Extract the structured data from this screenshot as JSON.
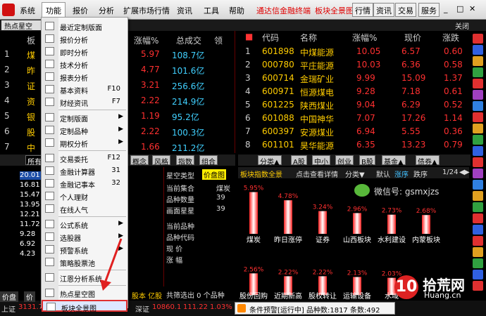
{
  "menubar": {
    "items": [
      "系统",
      "功能",
      "报价",
      "分析",
      "扩展市场行情",
      "资讯",
      "工具",
      "帮助"
    ],
    "promo1": "通达信金融终端",
    "promo2": "板块全景图",
    "right_buttons": [
      "行情",
      "资讯",
      "交易",
      "服务"
    ]
  },
  "toolbar": {
    "hot_tab": "热点星空",
    "close_label": "关闭"
  },
  "left_table": {
    "headers": [
      "板",
      "涨幅%",
      "总成交",
      "领"
    ],
    "rows": [
      {
        "name": "煤",
        "pct": "5.97",
        "vol": "108.7亿"
      },
      {
        "name": "昨",
        "pct": "4.77",
        "vol": "101.6亿"
      },
      {
        "name": "证",
        "pct": "3.21",
        "vol": "256.6亿"
      },
      {
        "name": "资",
        "pct": "2.22",
        "vol": "214.9亿"
      },
      {
        "name": "银",
        "pct": "1.19",
        "vol": "95.2亿"
      },
      {
        "name": "股",
        "pct": "2.22",
        "vol": "100.3亿"
      },
      {
        "name": "中",
        "pct": "1.66",
        "vol": "211.2亿"
      }
    ]
  },
  "right_table": {
    "headers": [
      "代码",
      "名称",
      "涨幅%",
      "现价",
      "涨跌"
    ],
    "rows": [
      {
        "n": "1",
        "code": "601898",
        "name": "中煤能源",
        "pct": "10.05",
        "price": "6.57",
        "chg": "0.60"
      },
      {
        "n": "2",
        "code": "000780",
        "name": "平庄能源",
        "pct": "10.03",
        "price": "6.36",
        "chg": "0.58"
      },
      {
        "n": "3",
        "code": "600714",
        "name": "金瑞矿业",
        "pct": "9.99",
        "price": "15.09",
        "chg": "1.37"
      },
      {
        "n": "4",
        "code": "600971",
        "name": "恒源煤电",
        "pct": "9.28",
        "price": "7.18",
        "chg": "0.61"
      },
      {
        "n": "5",
        "code": "601225",
        "name": "陕西煤业",
        "pct": "9.04",
        "price": "6.29",
        "chg": "0.52"
      },
      {
        "n": "6",
        "code": "601088",
        "name": "中国神华",
        "pct": "7.07",
        "price": "17.26",
        "chg": "1.14"
      },
      {
        "n": "7",
        "code": "600397",
        "name": "安源煤业",
        "pct": "6.94",
        "price": "5.55",
        "chg": "0.36"
      },
      {
        "n": "8",
        "code": "601101",
        "name": "昊华能源",
        "pct": "6.35",
        "price": "13.23",
        "chg": "0.79"
      }
    ]
  },
  "left_tabs": [
    "所有",
    "概念",
    "风格",
    "指数",
    "组合"
  ],
  "right_tabs": [
    "分类▲",
    "A股",
    "中小",
    "创业",
    "B股",
    "基金▲",
    "债券▲"
  ],
  "left_values": [
    "20.01",
    "16.81",
    "15.47",
    "13.95",
    "12.21",
    "11.72",
    "9.28",
    "6.92",
    "4.23"
  ],
  "mid_panel": {
    "title1": "星空类型",
    "title2": "价盘图",
    "rows": [
      {
        "k": "当前集合",
        "v": "煤炭"
      },
      {
        "k": "品种数量",
        "v": "39"
      },
      {
        "k": "画面星星",
        "v": "39"
      }
    ],
    "rows2": [
      "当前品种",
      "品种代码",
      "现 价",
      "涨 幅"
    ],
    "status": "共筛选出 0 个品种"
  },
  "chart_panel": {
    "title": "板块指数全景",
    "hint": "点击查看详情",
    "sort": "分类▼",
    "default": "默认",
    "rise": "涨序",
    "fall": "跌序",
    "page": "1/24",
    "wechat": "微信号: gsmxjzs"
  },
  "chart_data": [
    {
      "type": "bar",
      "categories": [
        "煤炭",
        "昨日涨停",
        "证券",
        "山西板块",
        "水利建设",
        "内蒙板块"
      ],
      "values": [
        5.95,
        4.78,
        3.24,
        2.96,
        2.73,
        2.68
      ],
      "ylim": [
        0,
        6
      ]
    },
    {
      "type": "bar",
      "categories": [
        "股份回购",
        "近期新高",
        "股权转让",
        "运输设备",
        "水域"
      ],
      "values": [
        2.56,
        2.22,
        2.22,
        2.13,
        2.03
      ],
      "ylim": [
        0,
        3
      ]
    }
  ],
  "menu": {
    "items": [
      {
        "label": "最近定制版面",
        "shortcut": "",
        "arrow": false
      },
      {
        "label": "报价分析",
        "shortcut": "",
        "arrow": false
      },
      {
        "label": "即时分析",
        "shortcut": "",
        "arrow": false
      },
      {
        "label": "技术分析",
        "shortcut": "",
        "arrow": false
      },
      {
        "label": "报表分析",
        "shortcut": "",
        "arrow": false
      },
      {
        "label": "基本资料",
        "shortcut": "F10",
        "arrow": false
      },
      {
        "label": "财经资讯",
        "shortcut": "F7",
        "arrow": false
      },
      {
        "label": "定制版面",
        "shortcut": "",
        "arrow": true
      },
      {
        "label": "定制品种",
        "shortcut": "",
        "arrow": true
      },
      {
        "label": "期权分析",
        "shortcut": "",
        "arrow": true
      },
      {
        "label": "交易委托",
        "shortcut": "F12",
        "arrow": false
      },
      {
        "label": "金融计算器",
        "shortcut": "31",
        "arrow": false
      },
      {
        "label": "金融记事本",
        "shortcut": "32",
        "arrow": false
      },
      {
        "label": "个人理财",
        "shortcut": "",
        "arrow": false
      },
      {
        "label": "在线人气",
        "shortcut": "",
        "arrow": false
      },
      {
        "label": "公式系统",
        "shortcut": "",
        "arrow": true
      },
      {
        "label": "选股器",
        "shortcut": "",
        "arrow": true
      },
      {
        "label": "预警系统",
        "shortcut": "",
        "arrow": true
      },
      {
        "label": "策略股票池",
        "shortcut": "",
        "arrow": false
      },
      {
        "label": "江恩分析系统",
        "shortcut": "",
        "arrow": false
      },
      {
        "label": "热点星空图",
        "shortcut": "",
        "arrow": false
      },
      {
        "label": "板块全景图",
        "shortcut": "",
        "arrow": false
      }
    ]
  },
  "bottom": {
    "left_tabs": [
      "价盘",
      "价"
    ],
    "stock_label": "股本 亿股",
    "idx1": "上证",
    "idx1_val": "3131.7",
    "idx2": "深证",
    "idx2_val": "10860.1",
    "idx2_chg": "111.22",
    "idx2_pct": "1.03%",
    "status_text": "条件预警[运行中] 品种数:1817 条数:492"
  },
  "watermark": {
    "brand": "拾荒网",
    "domain": "Huang.cn"
  }
}
